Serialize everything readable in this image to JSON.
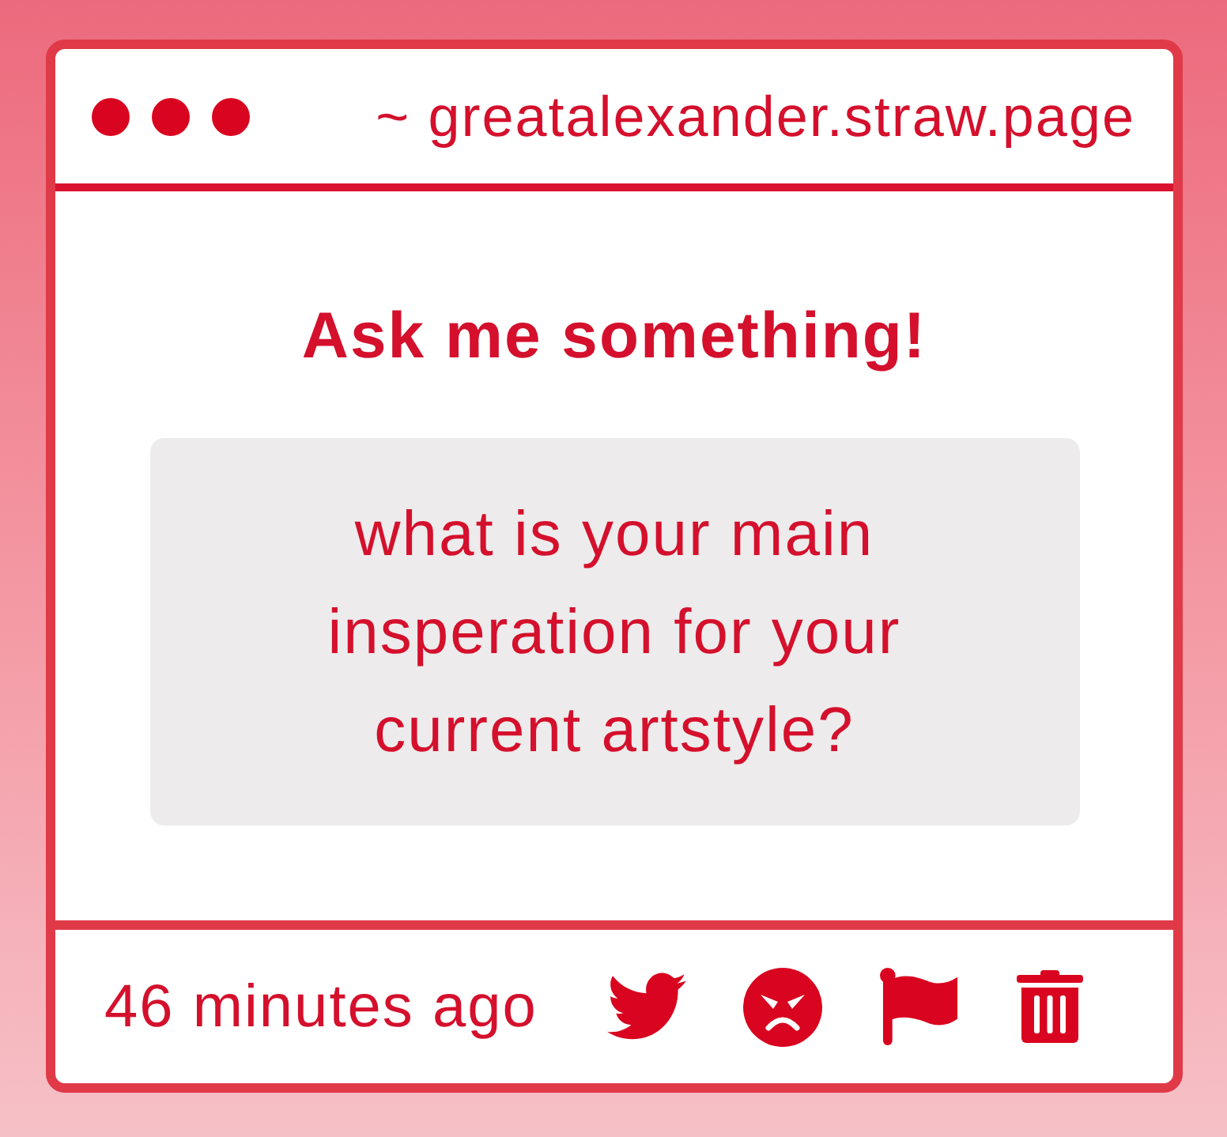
{
  "title_bar": {
    "url": "~ greatalexander.straw.page"
  },
  "heading": "Ask me something!",
  "question": "what is your main insperation for your current artstyle?",
  "footer": {
    "time": "46 minutes ago"
  }
}
